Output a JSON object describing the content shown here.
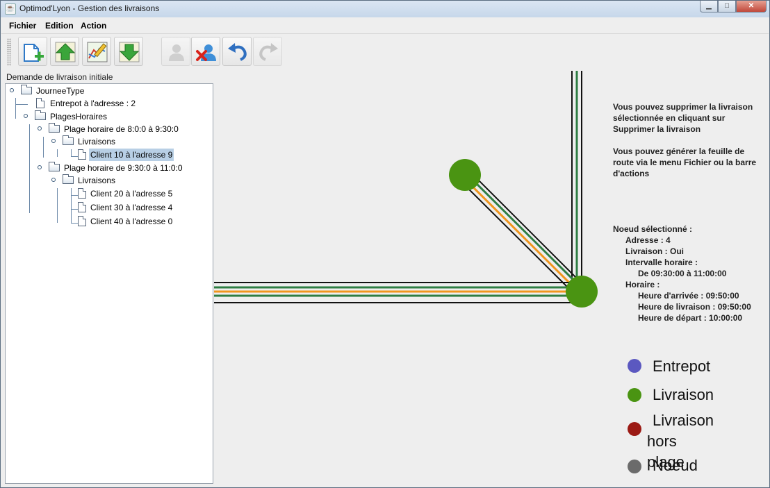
{
  "window": {
    "title": "Optimod'Lyon - Gestion des livraisons",
    "buttons": [
      "minimize",
      "maximize",
      "close"
    ]
  },
  "menu": {
    "items": [
      "Fichier",
      "Edition",
      "Action"
    ]
  },
  "toolbar": {
    "buttons": [
      {
        "name": "new-file-icon",
        "enabled": true
      },
      {
        "name": "upload-icon",
        "enabled": true
      },
      {
        "name": "map-edit-icon",
        "enabled": true
      },
      {
        "name": "download-icon",
        "enabled": true
      },
      {
        "name": "add-user-icon",
        "enabled": false
      },
      {
        "name": "delete-user-icon",
        "enabled": true
      },
      {
        "name": "undo-icon",
        "enabled": true
      },
      {
        "name": "redo-icon",
        "enabled": false
      }
    ]
  },
  "tree": {
    "title": "Demande de livraison initiale",
    "root": "JourneeType",
    "entrepot": "Entrepot à l'adresse : 2",
    "plages": "PlagesHoraires",
    "plage1": "Plage horaire de 8:0:0 à 9:30:0",
    "livraisons1": "Livraisons",
    "client10": "Client 10 à l'adresse 9",
    "plage2": "Plage horaire de 9:30:0 à 11:0:0",
    "livraisons2": "Livraisons",
    "client20": "Client 20 à l'adresse 5",
    "client30": "Client 30 à l'adresse 4",
    "client40": "Client 40 à l'adresse 0"
  },
  "info": {
    "msg1_line1": "Vous pouvez supprimer la livraison",
    "msg1_line2": "sélectionnée en cliquant sur",
    "msg1_line3": "Supprimer la livraison",
    "msg2_line1": "Vous pouvez générer la feuille de",
    "msg2_line2": "route via le menu Fichier ou la barre",
    "msg2_line3": "d'actions",
    "node_title": "Noeud sélectionné :",
    "adresse": "Adresse : 4",
    "livraison": "Livraison : Oui",
    "intervalle": "Intervalle horaire :",
    "intervalle_value": "De 09:30:00 à 11:00:00",
    "horaire": "Horaire :",
    "arrivee": "Heure d'arrivée : 09:50:00",
    "livraison_time": "Heure de livraison : 09:50:00",
    "depart": "Heure de départ : 10:00:00"
  },
  "legend": {
    "entrepot": "Entrepot",
    "livraison": "Livraison",
    "hors_plage_1": "Livraison",
    "hors_plage_2": "hors plage",
    "noeud": "Noeud"
  },
  "colors": {
    "entrepot": "#5b58c0",
    "livraison": "#4a9412",
    "hors_plage": "#9b1a14",
    "noeud": "#6b6b6b",
    "route_green": "#2e7d43",
    "route_orange": "#f0961e",
    "selection": "#b8cfe5"
  }
}
